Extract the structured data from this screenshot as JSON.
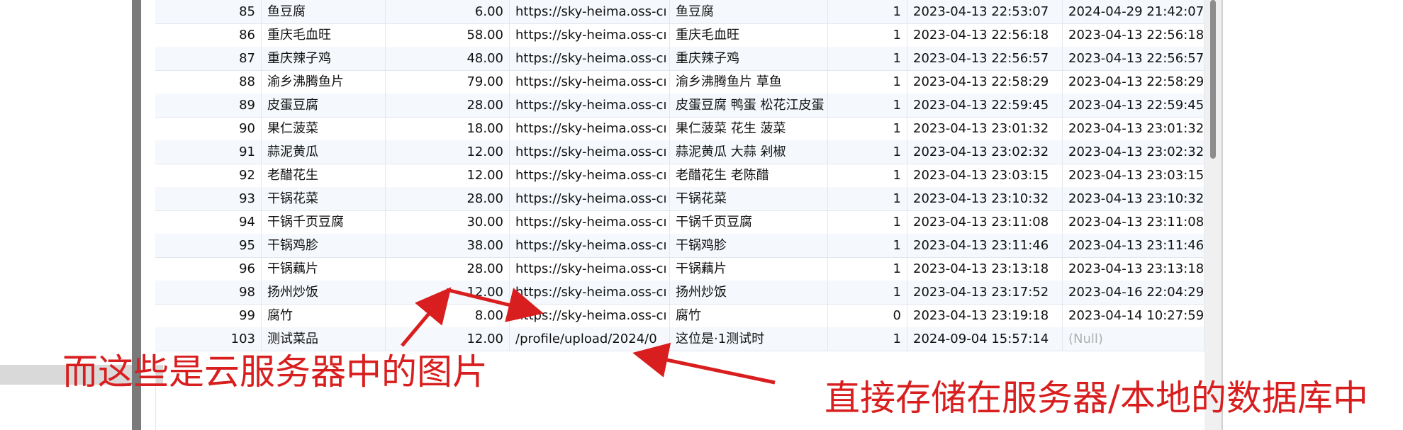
{
  "table": {
    "rows": [
      {
        "id": "85",
        "name": "鱼豆腐",
        "price": "6.00",
        "image": "https://sky-heima.oss-cı",
        "description": "鱼豆腐",
        "status": "1",
        "create_time": "2023-04-13 22:53:07",
        "update_time": "2024-04-29 21:42:07"
      },
      {
        "id": "86",
        "name": "重庆毛血旺",
        "price": "58.00",
        "image": "https://sky-heima.oss-cı",
        "description": "重庆毛血旺",
        "status": "1",
        "create_time": "2023-04-13 22:56:18",
        "update_time": "2023-04-13 22:56:18"
      },
      {
        "id": "87",
        "name": "重庆辣子鸡",
        "price": "48.00",
        "image": "https://sky-heima.oss-cı",
        "description": "重庆辣子鸡",
        "status": "1",
        "create_time": "2023-04-13 22:56:57",
        "update_time": "2023-04-13 22:56:57"
      },
      {
        "id": "88",
        "name": "渝乡沸腾鱼片",
        "price": "79.00",
        "image": "https://sky-heima.oss-cı",
        "description": "渝乡沸腾鱼片 草鱼",
        "status": "1",
        "create_time": "2023-04-13 22:58:29",
        "update_time": "2023-04-13 22:58:29"
      },
      {
        "id": "89",
        "name": "皮蛋豆腐",
        "price": "28.00",
        "image": "https://sky-heima.oss-cı",
        "description": "皮蛋豆腐 鸭蛋 松花江皮蛋",
        "status": "1",
        "create_time": "2023-04-13 22:59:45",
        "update_time": "2023-04-13 22:59:45"
      },
      {
        "id": "90",
        "name": "果仁菠菜",
        "price": "18.00",
        "image": "https://sky-heima.oss-cı",
        "description": "果仁菠菜 花生 菠菜",
        "status": "1",
        "create_time": "2023-04-13 23:01:32",
        "update_time": "2023-04-13 23:01:32"
      },
      {
        "id": "91",
        "name": "蒜泥黄瓜",
        "price": "12.00",
        "image": "https://sky-heima.oss-cı",
        "description": "蒜泥黄瓜 大蒜 剁椒",
        "status": "1",
        "create_time": "2023-04-13 23:02:32",
        "update_time": "2023-04-13 23:02:32"
      },
      {
        "id": "92",
        "name": "老醋花生",
        "price": "12.00",
        "image": "https://sky-heima.oss-cı",
        "description": "老醋花生 老陈醋",
        "status": "1",
        "create_time": "2023-04-13 23:03:15",
        "update_time": "2023-04-13 23:03:15"
      },
      {
        "id": "93",
        "name": "干锅花菜",
        "price": "28.00",
        "image": "https://sky-heima.oss-cı",
        "description": "干锅花菜",
        "status": "1",
        "create_time": "2023-04-13 23:10:32",
        "update_time": "2023-04-13 23:10:32"
      },
      {
        "id": "94",
        "name": "干锅千页豆腐",
        "price": "30.00",
        "image": "https://sky-heima.oss-cı",
        "description": "干锅千页豆腐",
        "status": "1",
        "create_time": "2023-04-13 23:11:08",
        "update_time": "2023-04-13 23:11:08"
      },
      {
        "id": "95",
        "name": "干锅鸡胗",
        "price": "38.00",
        "image": "https://sky-heima.oss-cı",
        "description": "干锅鸡胗",
        "status": "1",
        "create_time": "2023-04-13 23:11:46",
        "update_time": "2023-04-13 23:11:46"
      },
      {
        "id": "96",
        "name": "干锅藕片",
        "price": "28.00",
        "image": "https://sky-heima.oss-cı",
        "description": "干锅藕片",
        "status": "1",
        "create_time": "2023-04-13 23:13:18",
        "update_time": "2023-04-13 23:13:18"
      },
      {
        "id": "98",
        "name": "扬州炒饭",
        "price": "12.00",
        "image": "https://sky-heima.oss-cı",
        "description": "扬州炒饭",
        "status": "1",
        "create_time": "2023-04-13 23:17:52",
        "update_time": "2023-04-16 22:04:29"
      },
      {
        "id": "99",
        "name": "腐竹",
        "price": "8.00",
        "image": "https://sky-heima.oss-cı",
        "description": "腐竹",
        "status": "0",
        "create_time": "2023-04-13 23:19:18",
        "update_time": "2023-04-14 10:27:59"
      },
      {
        "id": "103",
        "name": "测试菜品",
        "price": "12.00",
        "image": "/profile/upload/2024/0",
        "description": "这位是·1测试时",
        "status": "1",
        "create_time": "2024-09-04 15:57:14",
        "update_time": "(Null)"
      }
    ]
  },
  "annotations": {
    "left_text": "而这些是云服务器中的图片",
    "right_text": "直接存储在服务器/本地的数据库中",
    "color": "#d81e1e"
  },
  "colors": {
    "row_alt": "#f5f8fc",
    "grid_line": "#e3e8ef",
    "null_text": "#b0b0b0"
  }
}
